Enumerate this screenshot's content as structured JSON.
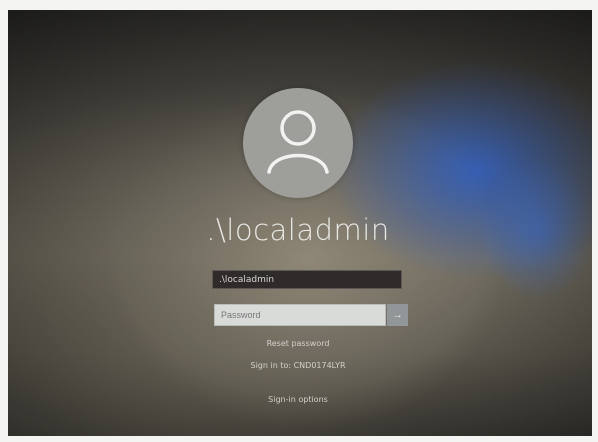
{
  "user": {
    "display_name": ".\\localadmin",
    "field_value": ".\\localadmin"
  },
  "password": {
    "placeholder": "Password",
    "submit_icon": "arrow-right-icon"
  },
  "links": {
    "reset_password": "Reset password",
    "sign_in_to": "Sign in to: CND0174LYR",
    "sign_in_options": "Sign-in options"
  },
  "colors": {
    "accent_blue": "#2d5fc8",
    "avatar_bg": "#9d9d98"
  }
}
